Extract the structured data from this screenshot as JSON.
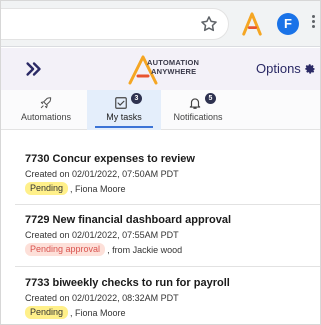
{
  "browser": {
    "avatar_letter": "F",
    "star_icon": "star-outline-icon",
    "extension_icon": "automation-anywhere-logo-icon",
    "menu_icon": "kebab-menu-icon"
  },
  "header": {
    "expand_icon": "double-chevron-right-icon",
    "logo_line1": "AUTOMATION",
    "logo_line2": "ANYWHERE",
    "options_label": "Options",
    "options_icon": "gear-icon"
  },
  "tabs": [
    {
      "label": "Automations",
      "icon": "rocket-icon"
    },
    {
      "label": "My tasks",
      "icon": "checkbox-icon",
      "badge": "3",
      "active": true
    },
    {
      "label": "Notifications",
      "icon": "bell-icon",
      "badge": "5"
    }
  ],
  "tasks": [
    {
      "title": "7730 Concur expenses to review",
      "created": "Created on 02/01/2022, 07:50AM PDT",
      "status": "Pending",
      "status_color": "#fff08a",
      "assignee": ", Fiona Moore"
    },
    {
      "title": "7729 New financial dashboard approval",
      "created": "Created on 02/01/2022, 07:55AM PDT",
      "status": "Pending approval",
      "status_color": "#fde0d9",
      "assignee": ", from Jackie wood"
    },
    {
      "title": "7733 biweekly checks to run for payroll",
      "created": "Created on 02/01/2022, 08:32AM PDT",
      "status": "Pending",
      "status_color": "#fff08a",
      "assignee": ", Fiona Moore"
    }
  ],
  "colors": {
    "accent": "#3b73d6",
    "header_bg": "#f3f1f8",
    "options_text": "#2b2a66"
  }
}
